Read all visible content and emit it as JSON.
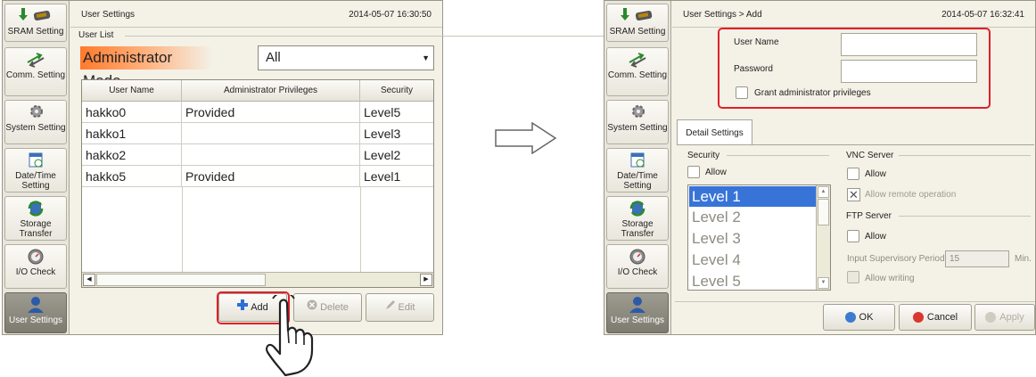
{
  "sidebar_items": [
    "SRAM Setting",
    "Comm. Setting",
    "System Setting",
    "Date/Time Setting",
    "Storage Transfer",
    "I/O Check",
    "User Settings"
  ],
  "before": {
    "title": "User Settings",
    "datetime": "2014-05-07  16:30:50",
    "user_list_label": "User List",
    "mode": "Administrator Mode",
    "filter_value": "All",
    "columns": [
      "User Name",
      "Administrator Privileges",
      "Security"
    ],
    "rows": [
      [
        "hakko0",
        "Provided",
        "Level5"
      ],
      [
        "hakko1",
        "",
        "Level3"
      ],
      [
        "hakko2",
        "",
        "Level2"
      ],
      [
        "hakko5",
        "Provided",
        "Level1"
      ]
    ],
    "buttons": {
      "add": "Add",
      "delete": "Delete",
      "edit": "Edit"
    }
  },
  "after": {
    "title": "User Settings > Add",
    "datetime": "2014-05-07  16:32:41",
    "user_name_label": "User Name",
    "password_label": "Password",
    "user_name_value": "",
    "password_value": "",
    "grant_label": "Grant administrator privileges",
    "tab_label": "Detail Settings",
    "security_group": "Security",
    "security_allow": "Allow",
    "levels": [
      "Level 1",
      "Level 2",
      "Level 3",
      "Level 4",
      "Level 5"
    ],
    "selected_level": "Level 1",
    "vnc_group": "VNC Server",
    "vnc_allow": "Allow",
    "vnc_remote": "Allow remote operation",
    "ftp_group": "FTP Server",
    "ftp_allow": "Allow",
    "supervisory_label": "Input Supervisory Period",
    "supervisory_value": "15",
    "supervisory_unit": "Min.",
    "allow_writing": "Allow writing",
    "buttons": {
      "ok": "OK",
      "cancel": "Cancel",
      "apply": "Apply"
    }
  },
  "colors": {
    "highlight": "#e0202a",
    "selection": "#3874d8",
    "mode_banner": "#ff7a2c"
  }
}
